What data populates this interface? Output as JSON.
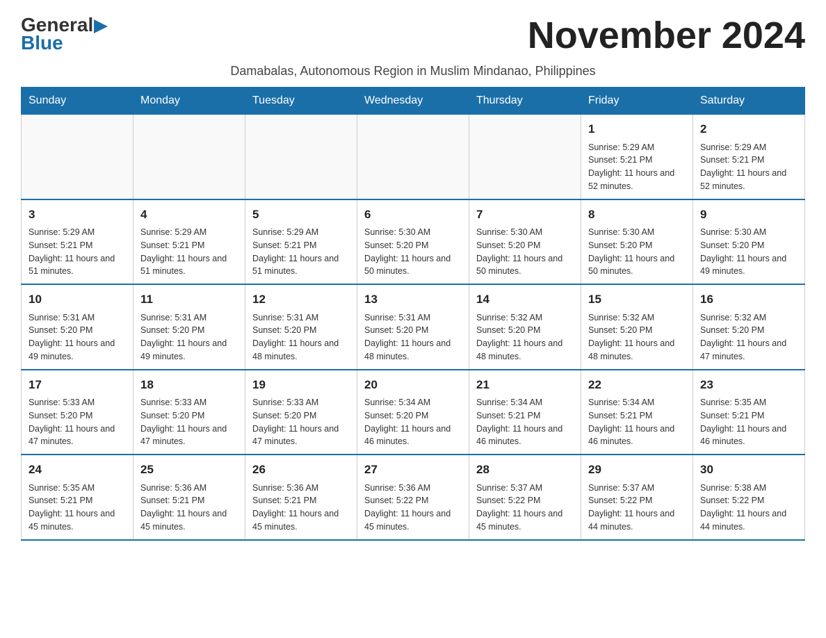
{
  "logo": {
    "text_general": "General",
    "text_blue": "Blue"
  },
  "title": "November 2024",
  "subtitle": "Damabalas, Autonomous Region in Muslim Mindanao, Philippines",
  "weekdays": [
    "Sunday",
    "Monday",
    "Tuesday",
    "Wednesday",
    "Thursday",
    "Friday",
    "Saturday"
  ],
  "weeks": [
    [
      {
        "day": "",
        "info": ""
      },
      {
        "day": "",
        "info": ""
      },
      {
        "day": "",
        "info": ""
      },
      {
        "day": "",
        "info": ""
      },
      {
        "day": "",
        "info": ""
      },
      {
        "day": "1",
        "info": "Sunrise: 5:29 AM\nSunset: 5:21 PM\nDaylight: 11 hours and 52 minutes."
      },
      {
        "day": "2",
        "info": "Sunrise: 5:29 AM\nSunset: 5:21 PM\nDaylight: 11 hours and 52 minutes."
      }
    ],
    [
      {
        "day": "3",
        "info": "Sunrise: 5:29 AM\nSunset: 5:21 PM\nDaylight: 11 hours and 51 minutes."
      },
      {
        "day": "4",
        "info": "Sunrise: 5:29 AM\nSunset: 5:21 PM\nDaylight: 11 hours and 51 minutes."
      },
      {
        "day": "5",
        "info": "Sunrise: 5:29 AM\nSunset: 5:21 PM\nDaylight: 11 hours and 51 minutes."
      },
      {
        "day": "6",
        "info": "Sunrise: 5:30 AM\nSunset: 5:20 PM\nDaylight: 11 hours and 50 minutes."
      },
      {
        "day": "7",
        "info": "Sunrise: 5:30 AM\nSunset: 5:20 PM\nDaylight: 11 hours and 50 minutes."
      },
      {
        "day": "8",
        "info": "Sunrise: 5:30 AM\nSunset: 5:20 PM\nDaylight: 11 hours and 50 minutes."
      },
      {
        "day": "9",
        "info": "Sunrise: 5:30 AM\nSunset: 5:20 PM\nDaylight: 11 hours and 49 minutes."
      }
    ],
    [
      {
        "day": "10",
        "info": "Sunrise: 5:31 AM\nSunset: 5:20 PM\nDaylight: 11 hours and 49 minutes."
      },
      {
        "day": "11",
        "info": "Sunrise: 5:31 AM\nSunset: 5:20 PM\nDaylight: 11 hours and 49 minutes."
      },
      {
        "day": "12",
        "info": "Sunrise: 5:31 AM\nSunset: 5:20 PM\nDaylight: 11 hours and 48 minutes."
      },
      {
        "day": "13",
        "info": "Sunrise: 5:31 AM\nSunset: 5:20 PM\nDaylight: 11 hours and 48 minutes."
      },
      {
        "day": "14",
        "info": "Sunrise: 5:32 AM\nSunset: 5:20 PM\nDaylight: 11 hours and 48 minutes."
      },
      {
        "day": "15",
        "info": "Sunrise: 5:32 AM\nSunset: 5:20 PM\nDaylight: 11 hours and 48 minutes."
      },
      {
        "day": "16",
        "info": "Sunrise: 5:32 AM\nSunset: 5:20 PM\nDaylight: 11 hours and 47 minutes."
      }
    ],
    [
      {
        "day": "17",
        "info": "Sunrise: 5:33 AM\nSunset: 5:20 PM\nDaylight: 11 hours and 47 minutes."
      },
      {
        "day": "18",
        "info": "Sunrise: 5:33 AM\nSunset: 5:20 PM\nDaylight: 11 hours and 47 minutes."
      },
      {
        "day": "19",
        "info": "Sunrise: 5:33 AM\nSunset: 5:20 PM\nDaylight: 11 hours and 47 minutes."
      },
      {
        "day": "20",
        "info": "Sunrise: 5:34 AM\nSunset: 5:20 PM\nDaylight: 11 hours and 46 minutes."
      },
      {
        "day": "21",
        "info": "Sunrise: 5:34 AM\nSunset: 5:21 PM\nDaylight: 11 hours and 46 minutes."
      },
      {
        "day": "22",
        "info": "Sunrise: 5:34 AM\nSunset: 5:21 PM\nDaylight: 11 hours and 46 minutes."
      },
      {
        "day": "23",
        "info": "Sunrise: 5:35 AM\nSunset: 5:21 PM\nDaylight: 11 hours and 46 minutes."
      }
    ],
    [
      {
        "day": "24",
        "info": "Sunrise: 5:35 AM\nSunset: 5:21 PM\nDaylight: 11 hours and 45 minutes."
      },
      {
        "day": "25",
        "info": "Sunrise: 5:36 AM\nSunset: 5:21 PM\nDaylight: 11 hours and 45 minutes."
      },
      {
        "day": "26",
        "info": "Sunrise: 5:36 AM\nSunset: 5:21 PM\nDaylight: 11 hours and 45 minutes."
      },
      {
        "day": "27",
        "info": "Sunrise: 5:36 AM\nSunset: 5:22 PM\nDaylight: 11 hours and 45 minutes."
      },
      {
        "day": "28",
        "info": "Sunrise: 5:37 AM\nSunset: 5:22 PM\nDaylight: 11 hours and 45 minutes."
      },
      {
        "day": "29",
        "info": "Sunrise: 5:37 AM\nSunset: 5:22 PM\nDaylight: 11 hours and 44 minutes."
      },
      {
        "day": "30",
        "info": "Sunrise: 5:38 AM\nSunset: 5:22 PM\nDaylight: 11 hours and 44 minutes."
      }
    ]
  ]
}
